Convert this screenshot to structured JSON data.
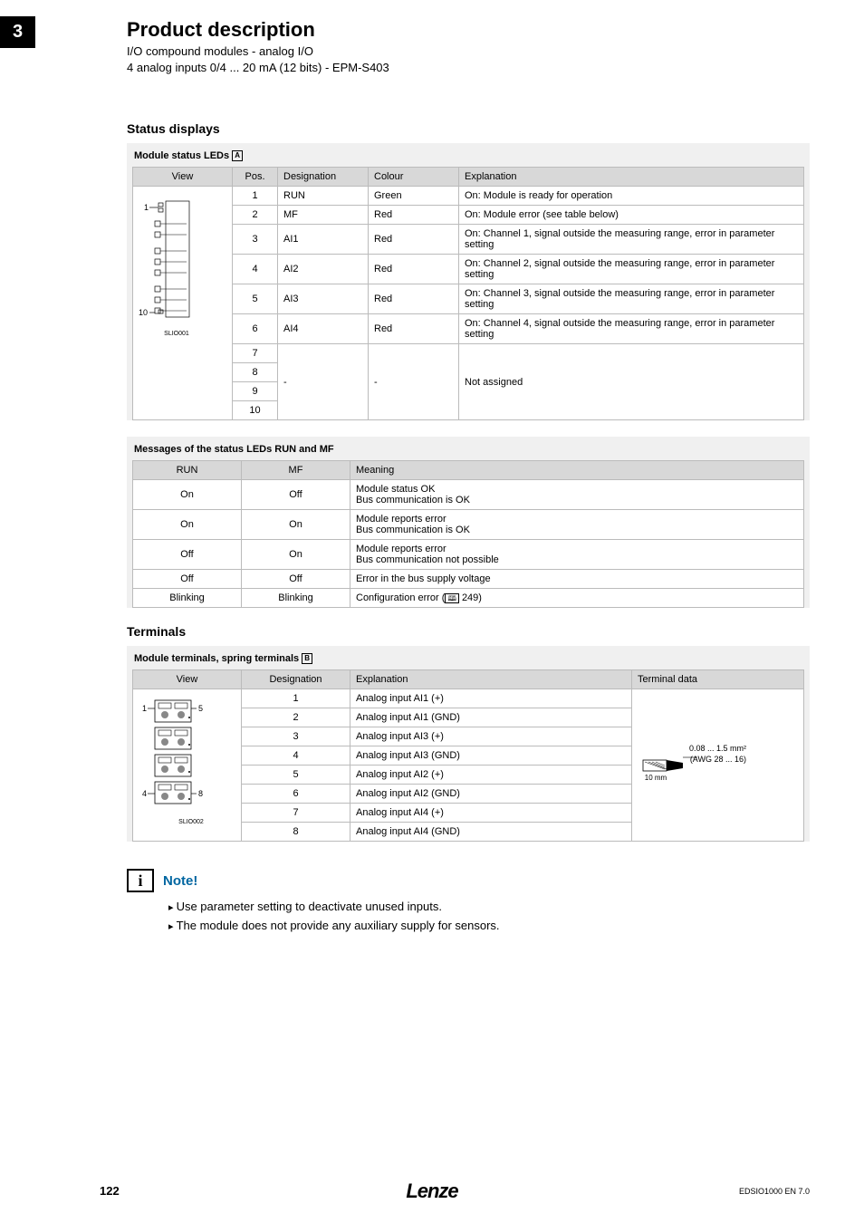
{
  "chapter": "3",
  "title": "Product description",
  "subtitle_line1": "I/O compound modules - analog I/O",
  "subtitle_line2": "4 analog inputs 0/4 ... 20 mA (12 bits) - EPM-S403",
  "section1": "Status displays",
  "table1": {
    "title": "Module status LEDs",
    "title_box": "A",
    "headers": {
      "view": "View",
      "pos": "Pos.",
      "des": "Designation",
      "col": "Colour",
      "exp": "Explanation"
    },
    "view_label_top": "1",
    "view_label_bot": "10",
    "view_caption": "SLIO001",
    "rows": [
      {
        "pos": "1",
        "des": "RUN",
        "col": "Green",
        "exp": "On: Module is ready for operation"
      },
      {
        "pos": "2",
        "des": "MF",
        "col": "Red",
        "exp": "On: Module error (see table below)"
      },
      {
        "pos": "3",
        "des": "AI1",
        "col": "Red",
        "exp": "On: Channel 1, signal outside the measuring range, error in parameter setting"
      },
      {
        "pos": "4",
        "des": "AI2",
        "col": "Red",
        "exp": "On: Channel 2, signal outside the measuring range, error in parameter setting"
      },
      {
        "pos": "5",
        "des": "AI3",
        "col": "Red",
        "exp": "On: Channel 3, signal outside the measuring range, error in parameter setting"
      },
      {
        "pos": "6",
        "des": "AI4",
        "col": "Red",
        "exp": "On: Channel 4, signal outside the measuring range, error in parameter setting"
      }
    ],
    "na_pos": [
      "7",
      "8",
      "9",
      "10"
    ],
    "na_des": "-",
    "na_col": "-",
    "na_exp": "Not assigned"
  },
  "table2": {
    "title": "Messages of the status LEDs RUN and MF",
    "headers": {
      "run": "RUN",
      "mf": "MF",
      "mean": "Meaning"
    },
    "rows": [
      {
        "run": "On",
        "mf": "Off",
        "mean": "Module status OK\nBus communication is OK"
      },
      {
        "run": "On",
        "mf": "On",
        "mean": "Module reports error\nBus communication is OK"
      },
      {
        "run": "Off",
        "mf": "On",
        "mean": "Module reports error\nBus communication not possible"
      },
      {
        "run": "Off",
        "mf": "Off",
        "mean": "Error in the bus supply voltage"
      },
      {
        "run": "Blinking",
        "mf": "Blinking",
        "mean_pre": "Configuration error (",
        "mean_page": "249)",
        "mean_icon": "📖"
      }
    ]
  },
  "section2": "Terminals",
  "table3": {
    "title": "Module terminals, spring terminals",
    "title_box": "B",
    "headers": {
      "view": "View",
      "des": "Designation",
      "exp": "Explanation",
      "td": "Terminal data"
    },
    "view_label1": "1",
    "view_label5": "5",
    "view_label4": "4",
    "view_label8": "8",
    "view_caption": "SLIO002",
    "rows": [
      {
        "des": "1",
        "exp": "Analog input AI1 (+)"
      },
      {
        "des": "2",
        "exp": "Analog input AI1 (GND)"
      },
      {
        "des": "3",
        "exp": "Analog input AI3 (+)"
      },
      {
        "des": "4",
        "exp": "Analog input AI3 (GND)"
      },
      {
        "des": "5",
        "exp": "Analog input AI2 (+)"
      },
      {
        "des": "6",
        "exp": "Analog input AI2 (GND)"
      },
      {
        "des": "7",
        "exp": "Analog input AI4 (+)"
      },
      {
        "des": "8",
        "exp": "Analog input AI4 (GND)"
      }
    ],
    "td_line1": "0.08 ... 1.5 mm²",
    "td_line2": "(AWG 28 ... 16)",
    "td_line3": "10 mm"
  },
  "note": {
    "heading": "Note!",
    "items": [
      "Use parameter setting to deactivate unused inputs.",
      "The module does not provide any auxiliary supply for sensors."
    ]
  },
  "footer": {
    "page": "122",
    "brand": "Lenze",
    "docid": "EDSIO1000 EN 7.0"
  }
}
